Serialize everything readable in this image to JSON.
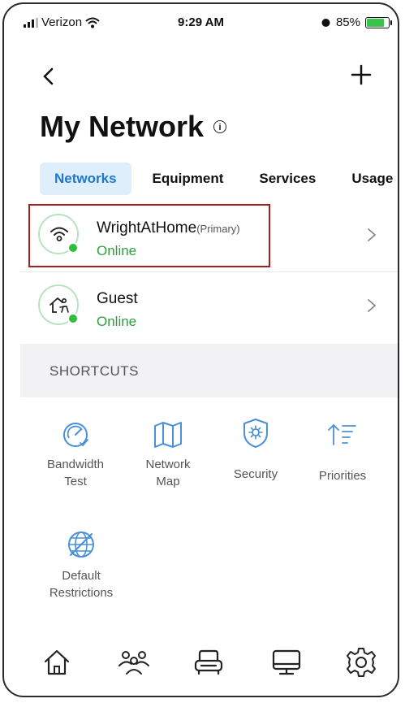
{
  "status_bar": {
    "carrier": "Verizon",
    "time": "9:29 AM",
    "battery": "85%",
    "battery_level": 0.85
  },
  "header": {
    "title": "My Network"
  },
  "tabs": [
    {
      "label": "Networks",
      "active": true
    },
    {
      "label": "Equipment",
      "active": false
    },
    {
      "label": "Services",
      "active": false
    },
    {
      "label": "Usage",
      "active": false
    }
  ],
  "networks": [
    {
      "name": "WrightAtHome",
      "tag": "(Primary)",
      "status": "Online",
      "icon": "wifi-icon"
    },
    {
      "name": "Guest",
      "status": "Online",
      "icon": "guest-home-icon"
    }
  ],
  "shortcuts": {
    "header": "SHORTCUTS",
    "items": [
      {
        "label_line1": "Bandwidth",
        "label_line2": "Test",
        "icon": "speedometer-icon"
      },
      {
        "label_line1": "Network",
        "label_line2": "Map",
        "icon": "map-icon"
      },
      {
        "label_line1": "Security",
        "label_line2": "",
        "icon": "shield-icon"
      },
      {
        "label_line1": "Priorities",
        "label_line2": "",
        "icon": "priorities-icon"
      },
      {
        "label_line1": "Default",
        "label_line2": "Restrictions",
        "icon": "globe-restricted-icon"
      }
    ]
  },
  "bottom_nav": [
    "home-icon",
    "people-icon",
    "sofa-icon",
    "monitor-icon",
    "settings-icon"
  ],
  "colors": {
    "accent": "#1f77c9",
    "online": "#2f9e3e",
    "highlight": "#a51f1f",
    "tab_bg": "#dfeefb"
  }
}
